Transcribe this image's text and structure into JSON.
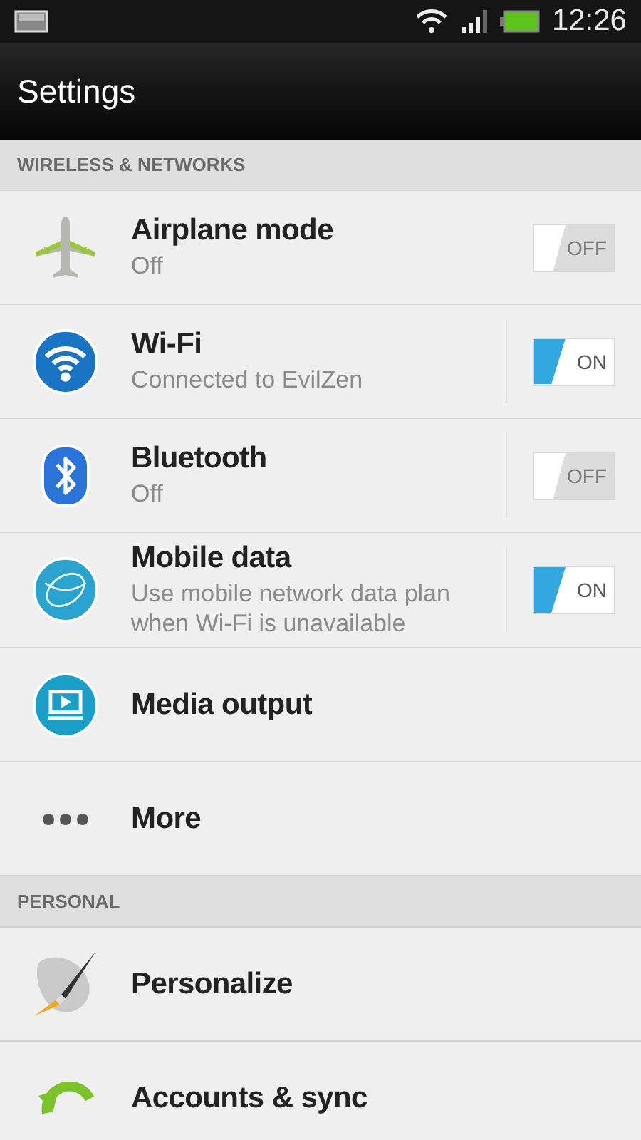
{
  "status_bar": {
    "time": "12:26"
  },
  "action_bar": {
    "title": "Settings"
  },
  "sections": [
    {
      "header": "WIRELESS & NETWORKS",
      "items": [
        {
          "title": "Airplane mode",
          "subtitle": "Off",
          "toggle": {
            "on": false,
            "label": "OFF"
          },
          "divider": false
        },
        {
          "title": "Wi-Fi",
          "subtitle": "Connected to EvilZen",
          "toggle": {
            "on": true,
            "label": "ON"
          },
          "divider": true
        },
        {
          "title": "Bluetooth",
          "subtitle": "Off",
          "toggle": {
            "on": false,
            "label": "OFF"
          },
          "divider": true
        },
        {
          "title": "Mobile data",
          "subtitle": "Use mobile network data plan when Wi-Fi is unavailable",
          "toggle": {
            "on": true,
            "label": "ON"
          },
          "divider": true
        },
        {
          "title": "Media output"
        },
        {
          "title": "More"
        }
      ]
    },
    {
      "header": "PERSONAL",
      "items": [
        {
          "title": "Personalize"
        },
        {
          "title": "Accounts & sync"
        }
      ]
    }
  ]
}
